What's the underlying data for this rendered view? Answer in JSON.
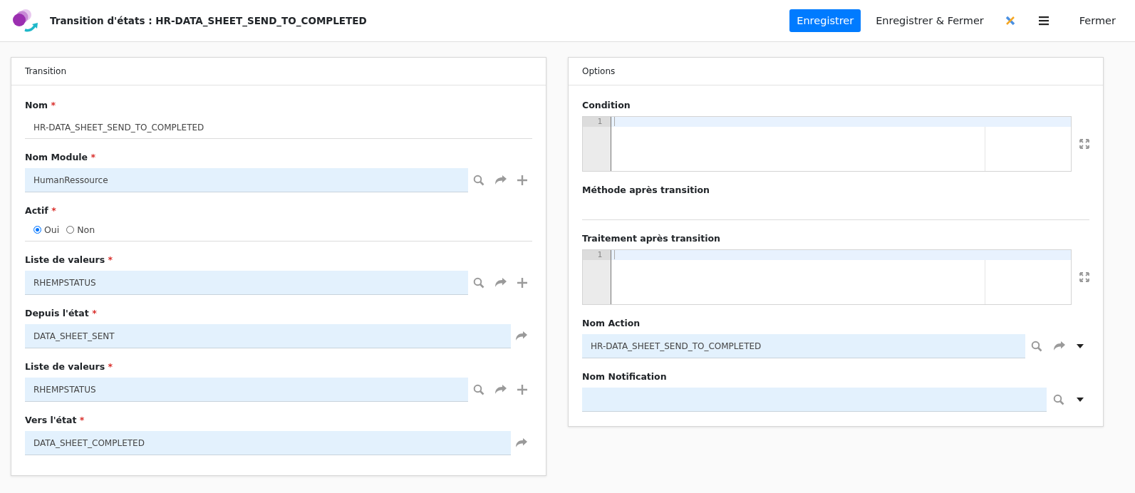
{
  "header": {
    "title": "Transition d'états : HR-DATA_SHEET_SEND_TO_COMPLETED",
    "buttons": [
      {
        "label": "Enregistrer",
        "kind": "primary"
      },
      {
        "label": "Enregistrer & Fermer",
        "kind": "link"
      },
      {
        "kind": "tools"
      },
      {
        "kind": "menu"
      },
      {
        "label": "Fermer",
        "kind": "link"
      }
    ]
  },
  "panels": [
    {
      "title": "Transition",
      "fields": [
        {
          "kind": "text",
          "label": "Nom",
          "mark": "*",
          "value": "HR-DATA_SHEET_SEND_TO_COMPLETED"
        },
        {
          "kind": "lookup",
          "label": "Nom Module",
          "mark": "*",
          "value": "HumanRessource",
          "search": true,
          "link": true,
          "add": true
        },
        {
          "kind": "radio",
          "label": "Actif",
          "mark": "*",
          "options": [
            {
              "label": "Oui",
              "selected": true
            },
            {
              "label": "Non",
              "selected": false
            }
          ]
        },
        {
          "kind": "lookup",
          "label": "Liste de valeurs",
          "mark": "*",
          "value": "RHEMPSTATUS",
          "search": true,
          "link": true,
          "add": true
        },
        {
          "kind": "lookup",
          "label": "Depuis l'état",
          "mark": "*",
          "value": "DATA_SHEET_SENT",
          "link": true
        },
        {
          "kind": "lookup",
          "label": "Liste de valeurs",
          "mark": "*",
          "value": "RHEMPSTATUS",
          "search": true,
          "link": true,
          "add": true
        },
        {
          "kind": "lookup",
          "label": "Vers l'état",
          "mark": "*",
          "value": "DATA_SHEET_COMPLETED",
          "link": true
        }
      ]
    },
    {
      "title": "Options",
      "fields": [
        {
          "kind": "code",
          "label": "Condition",
          "line_number": "1"
        },
        {
          "kind": "blank",
          "label": "Méthode après transition"
        },
        {
          "kind": "code",
          "label": "Traitement après transition",
          "line_number": "1"
        },
        {
          "kind": "lookup",
          "label": "Nom Action",
          "value": "HR-DATA_SHEET_SEND_TO_COMPLETED",
          "search": true,
          "link": true,
          "dropdown": true
        },
        {
          "kind": "lookup",
          "label": "Nom Notification",
          "search": true,
          "dropdown": true
        }
      ]
    }
  ]
}
